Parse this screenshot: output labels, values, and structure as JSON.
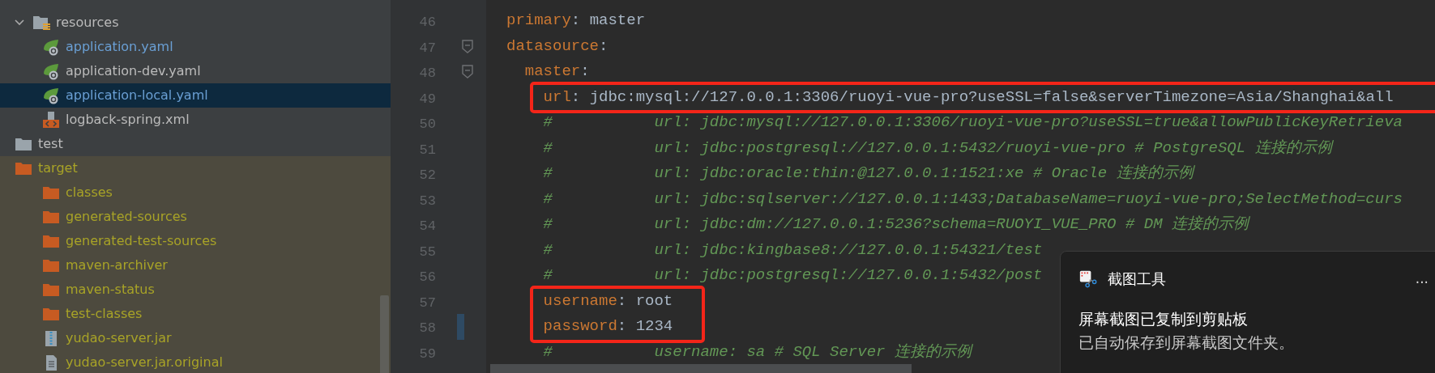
{
  "project_tree": {
    "items": [
      {
        "label": "resources",
        "kind": "resource-folder",
        "expanded": true,
        "selected": false,
        "excluded": false,
        "modified": false,
        "children": [
          {
            "label": "application.yaml",
            "kind": "spring-config",
            "selected": false,
            "excluded": false,
            "modified": true
          },
          {
            "label": "application-dev.yaml",
            "kind": "spring-config",
            "selected": false,
            "excluded": false,
            "modified": false
          },
          {
            "label": "application-local.yaml",
            "kind": "spring-config",
            "selected": true,
            "excluded": false,
            "modified": true
          },
          {
            "label": "logback-spring.xml",
            "kind": "xml",
            "selected": false,
            "excluded": false,
            "modified": false
          }
        ]
      },
      {
        "label": "test",
        "kind": "folder",
        "selected": false,
        "excluded": false,
        "modified": false
      },
      {
        "label": "target",
        "kind": "folder",
        "selected": false,
        "excluded": true,
        "modified": false,
        "children": [
          {
            "label": "classes",
            "kind": "folder",
            "selected": false,
            "excluded": true,
            "modified": false
          },
          {
            "label": "generated-sources",
            "kind": "folder",
            "selected": false,
            "excluded": true,
            "modified": false
          },
          {
            "label": "generated-test-sources",
            "kind": "folder",
            "selected": false,
            "excluded": true,
            "modified": false
          },
          {
            "label": "maven-archiver",
            "kind": "folder",
            "selected": false,
            "excluded": true,
            "modified": false
          },
          {
            "label": "maven-status",
            "kind": "folder",
            "selected": false,
            "excluded": true,
            "modified": false
          },
          {
            "label": "test-classes",
            "kind": "folder",
            "selected": false,
            "excluded": true,
            "modified": false
          },
          {
            "label": "yudao-server.jar",
            "kind": "jar",
            "selected": false,
            "excluded": true,
            "modified": false
          },
          {
            "label": "yudao-server.jar.original",
            "kind": "file",
            "selected": false,
            "excluded": true,
            "modified": false
          }
        ]
      }
    ]
  },
  "editor": {
    "lines": [
      {
        "number": "46",
        "kind": "pair",
        "key": "primary",
        "colon": ":",
        "value": "master",
        "fold": false,
        "changed": false,
        "boxed": false
      },
      {
        "number": "47",
        "kind": "section",
        "key": "datasource",
        "colon": ":",
        "fold": true,
        "changed": false,
        "boxed": false
      },
      {
        "number": "48",
        "kind": "section",
        "key": "  master",
        "colon": ":",
        "fold": true,
        "changed": false,
        "boxed": false
      },
      {
        "number": "49",
        "kind": "pair",
        "key": "    url",
        "colon": ":",
        "value": "jdbc:mysql://127.0.0.1:3306/ruoyi-vue-pro?useSSL=false&serverTimezone=Asia/Shanghai&all",
        "fold": false,
        "changed": false,
        "boxed": true
      },
      {
        "number": "50",
        "kind": "comment",
        "text": "    #           url: jdbc:mysql://127.0.0.1:3306/ruoyi-vue-pro?useSSL=true&allowPublicKeyRetrieva",
        "fold": false,
        "changed": false,
        "boxed": false
      },
      {
        "number": "51",
        "kind": "comment",
        "text": "    #           url: jdbc:postgresql://127.0.0.1:5432/ruoyi-vue-pro # PostgreSQL 连接的示例",
        "fold": false,
        "changed": false,
        "boxed": false
      },
      {
        "number": "52",
        "kind": "comment",
        "text": "    #           url: jdbc:oracle:thin:@127.0.0.1:1521:xe # Oracle 连接的示例",
        "fold": false,
        "changed": false,
        "boxed": false
      },
      {
        "number": "53",
        "kind": "comment",
        "text": "    #           url: jdbc:sqlserver://127.0.0.1:1433;DatabaseName=ruoyi-vue-pro;SelectMethod=curs",
        "fold": false,
        "changed": false,
        "boxed": false
      },
      {
        "number": "54",
        "kind": "comment",
        "text": "    #           url: jdbc:dm://127.0.0.1:5236?schema=RUOYI_VUE_PRO # DM 连接的示例",
        "fold": false,
        "changed": false,
        "boxed": false
      },
      {
        "number": "55",
        "kind": "comment",
        "text": "    #           url: jdbc:kingbase8://127.0.0.1:54321/test",
        "fold": false,
        "changed": false,
        "boxed": false
      },
      {
        "number": "56",
        "kind": "comment",
        "text": "    #           url: jdbc:postgresql://127.0.0.1:5432/post",
        "fold": false,
        "changed": false,
        "boxed": false
      },
      {
        "number": "57",
        "kind": "pair",
        "key": "    username",
        "colon": ":",
        "value": "root",
        "fold": false,
        "changed": false,
        "boxed": true
      },
      {
        "number": "58",
        "kind": "pair",
        "key": "    password",
        "colon": ":",
        "value": "1234",
        "fold": false,
        "changed": true,
        "boxed": true
      },
      {
        "number": "59",
        "kind": "comment",
        "text": "    #           username: sa # SQL Server 连接的示例",
        "fold": false,
        "changed": false,
        "boxed": false
      }
    ]
  },
  "notification": {
    "app_name": "截图工具",
    "menu": "...",
    "title": "屏幕截图已复制到剪贴板",
    "message": "已自动保存到屏幕截图文件夹。"
  }
}
